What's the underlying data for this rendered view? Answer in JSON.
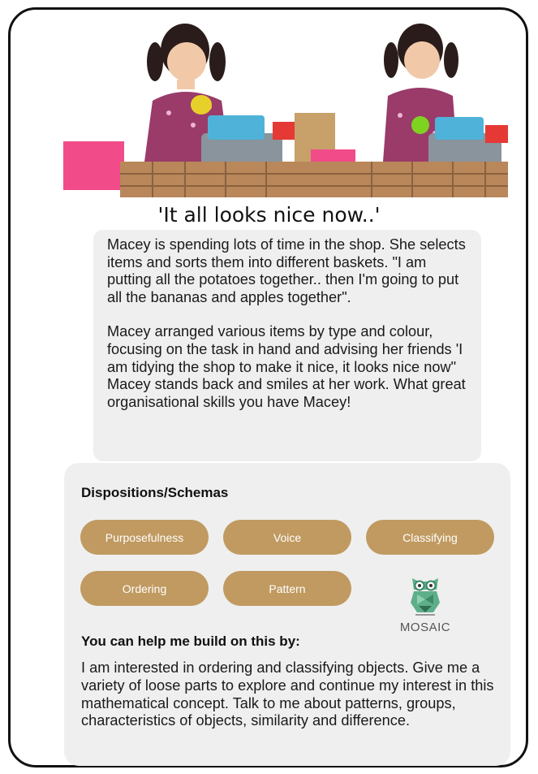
{
  "title": "'It all looks nice now..'",
  "story": {
    "paragraph1": "Macey is spending lots of time in the shop. She selects items and sorts them into different baskets. \"I am putting all the potatoes together.. then I'm going to put all the bananas and apples together\".",
    "paragraph2": "Macey arranged various items by type and colour, focusing on the task in hand and advising her friends 'I am tidying the shop to make it nice, it looks nice now\" Macey stands back and smiles at her work. What great organisational skills you have Macey!"
  },
  "dispositions": {
    "heading": "Dispositions/Schemas",
    "tags": [
      "Purposefulness",
      "Voice",
      "Classifying",
      "Ordering",
      "Pattern"
    ]
  },
  "logo": {
    "name": "MOSAIC",
    "icon": "owl-logo-icon",
    "color": "#5fae8a"
  },
  "build_on": {
    "heading": "You can help me build on this by:",
    "text": "I am interested in ordering and classifying objects. Give me a variety of loose parts to explore and continue my interest in this mathematical concept. Talk to me about patterns, groups, characteristics of objects, similarity and difference."
  },
  "colors": {
    "tag": "#c09a60",
    "panel": "#efefef"
  }
}
